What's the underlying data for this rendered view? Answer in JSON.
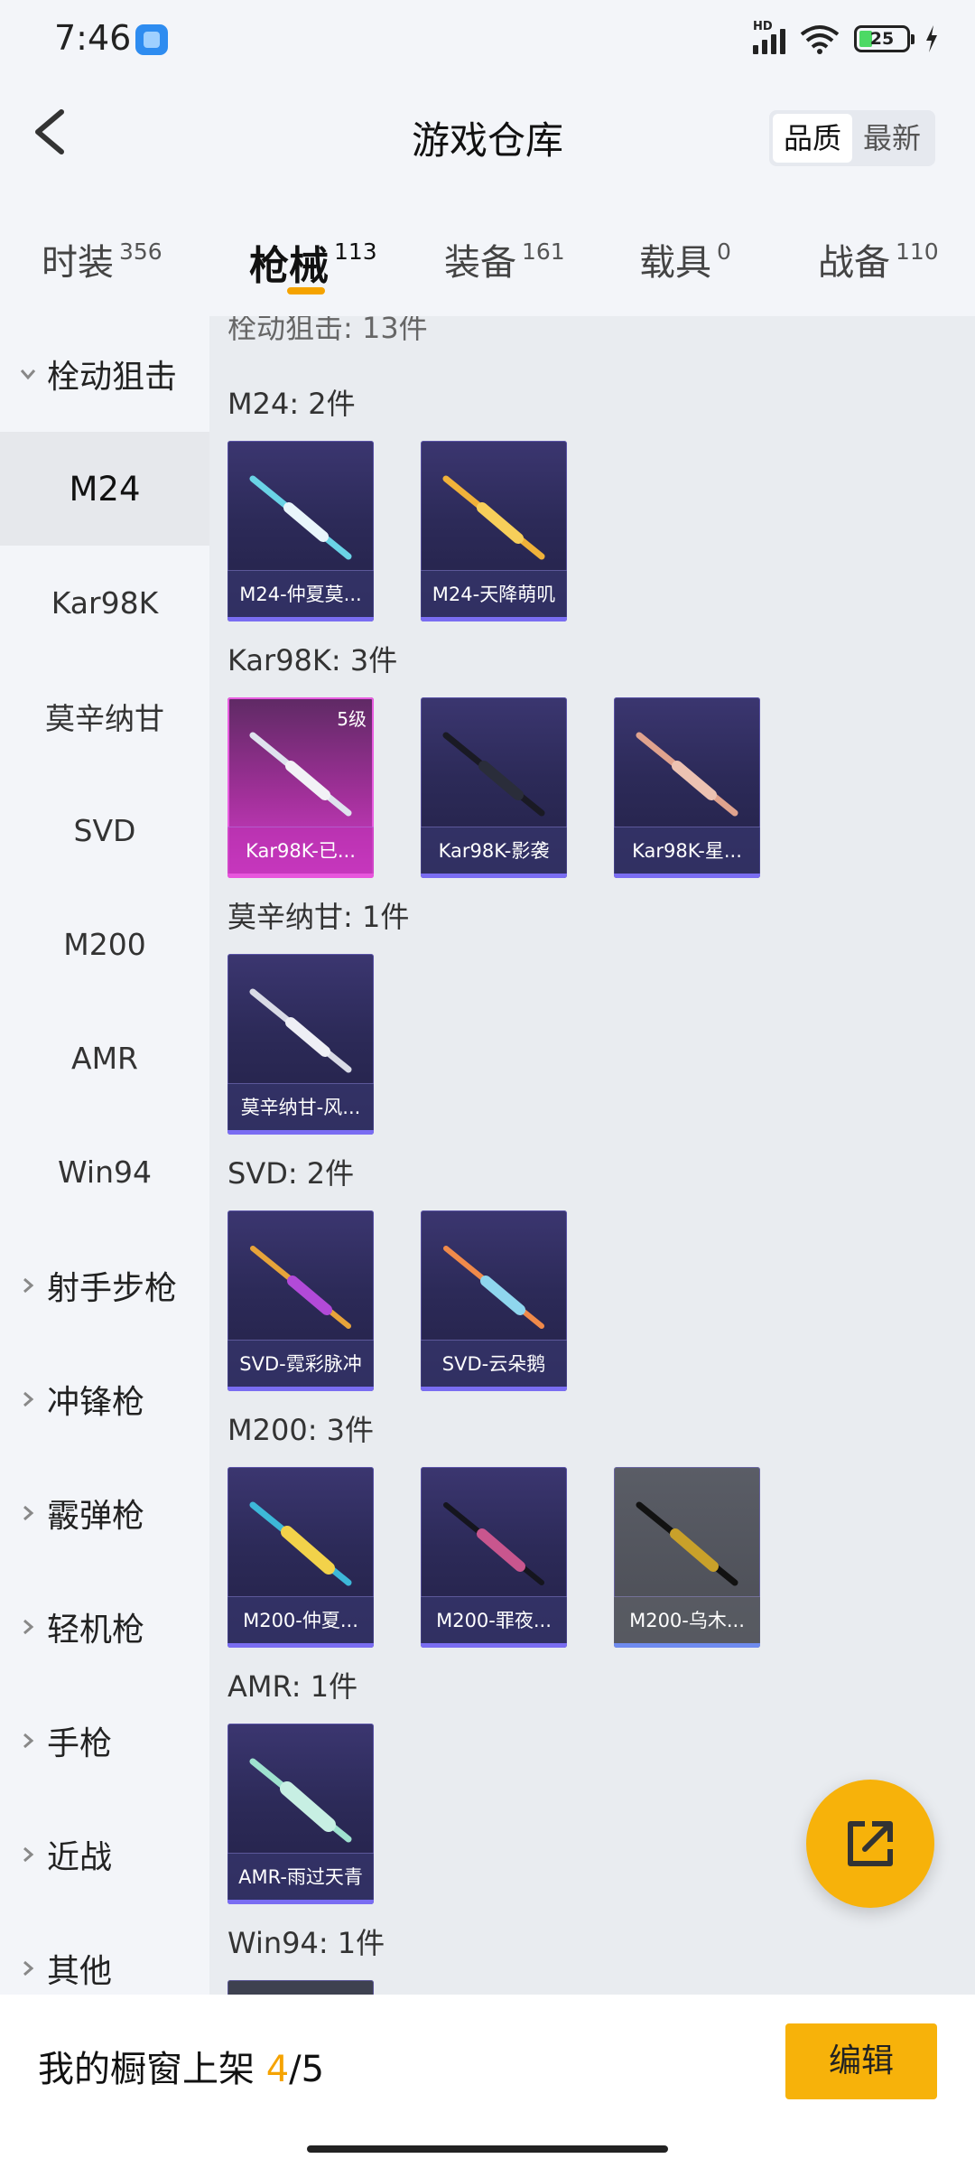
{
  "status_bar": {
    "time": "7:46",
    "hd": "HD",
    "battery": "25"
  },
  "header": {
    "title": "游戏仓库",
    "back_icon": "chevron-left-icon",
    "sort": {
      "quality": "品质",
      "newest": "最新",
      "selected": "品质"
    }
  },
  "tabs": [
    {
      "label": "时装",
      "count": "356"
    },
    {
      "label": "枪械",
      "count": "113",
      "active": true
    },
    {
      "label": "装备",
      "count": "161"
    },
    {
      "label": "载具",
      "count": "0"
    },
    {
      "label": "战备",
      "count": "110"
    }
  ],
  "sidebar": {
    "group_expanded": "栓动狙击",
    "sub_items": [
      "M24",
      "Kar98K",
      "莫辛纳甘",
      "SVD",
      "M200",
      "AMR",
      "Win94"
    ],
    "selected": "M24",
    "groups_collapsed": [
      "射手步枪",
      "冲锋枪",
      "霰弹枪",
      "轻机枪",
      "手枪",
      "近战",
      "其他"
    ]
  },
  "content": {
    "partial_header": "栓动狙击: 13件",
    "sections": [
      {
        "title": "M24: 2件",
        "items": [
          {
            "name": "M24-仲夏莫..."
          },
          {
            "name": "M24-天降萌叽"
          }
        ]
      },
      {
        "title": "Kar98K: 3件",
        "items": [
          {
            "name": "Kar98K-已...",
            "level": "5级",
            "rarity": "pink"
          },
          {
            "name": "Kar98K-影袭"
          },
          {
            "name": "Kar98K-星..."
          }
        ]
      },
      {
        "title": "莫辛纳甘: 1件",
        "items": [
          {
            "name": "莫辛纳甘-风..."
          }
        ]
      },
      {
        "title": "SVD: 2件",
        "items": [
          {
            "name": "SVD-霓彩脉冲"
          },
          {
            "name": "SVD-云朵鹅"
          }
        ]
      },
      {
        "title": "M200: 3件",
        "items": [
          {
            "name": "M200-仲夏..."
          },
          {
            "name": "M200-罪夜..."
          },
          {
            "name": "M200-乌木...",
            "rarity": "gray"
          }
        ]
      },
      {
        "title": "AMR: 1件",
        "items": [
          {
            "name": "AMR-雨过天青"
          }
        ]
      },
      {
        "title": "Win94: 1件",
        "items": []
      }
    ]
  },
  "fab": {
    "icon": "share-external-icon"
  },
  "bottom": {
    "showcase_label": "我的橱窗上架",
    "current": "4",
    "separator": "/",
    "total": "5",
    "edit_label": "编辑"
  },
  "colors": {
    "accent": "#f7b20a",
    "tab_underline": "#f5a300",
    "card_purple": "#2c2a58",
    "card_pink": "#d43fcb"
  }
}
